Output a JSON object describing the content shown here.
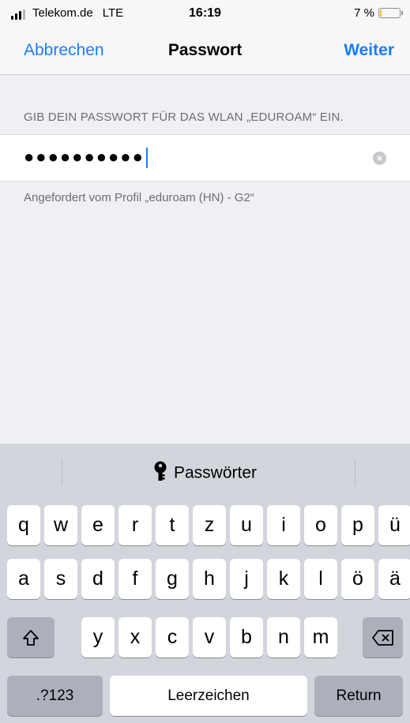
{
  "status_bar": {
    "carrier": "Telekom.de",
    "network": "LTE",
    "time": "16:19",
    "battery_percent_label": "7 %",
    "battery_level": 0.07,
    "battery_color": "#f2c218"
  },
  "nav": {
    "cancel_label": "Abbrechen",
    "title": "Passwort",
    "next_label": "Weiter",
    "accent_color": "#1a7ef6"
  },
  "form": {
    "header": "GIB DEIN PASSWORT FÜR DAS WLAN „EDUROAM“ EIN.",
    "password_masked": "●●●●●●●●●●",
    "footer": "Angefordert vom Profil „eduroam (HN) - G2“"
  },
  "keyboard": {
    "suggestion_label": "Passwörter",
    "suggestion_icon": "key-icon",
    "row1": [
      "q",
      "w",
      "e",
      "r",
      "t",
      "z",
      "u",
      "i",
      "o",
      "p",
      "ü"
    ],
    "row2": [
      "a",
      "s",
      "d",
      "f",
      "g",
      "h",
      "j",
      "k",
      "l",
      "ö",
      "ä"
    ],
    "row3": [
      "y",
      "x",
      "c",
      "v",
      "b",
      "n",
      "m"
    ],
    "numbers_label": ".?123",
    "space_label": "Leerzeichen",
    "return_label": "Return",
    "shift_icon": "shift-icon",
    "delete_icon": "delete-icon"
  }
}
